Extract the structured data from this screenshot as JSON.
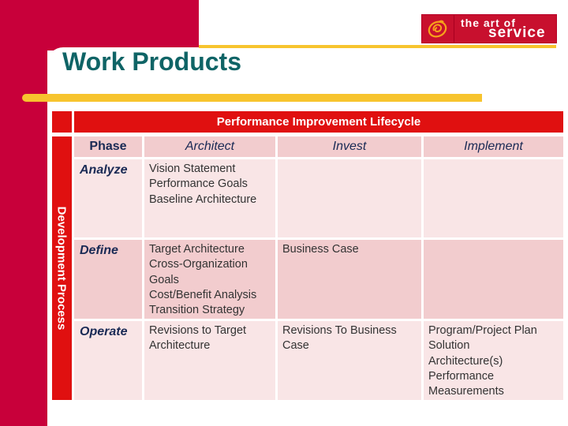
{
  "slide": {
    "title": "Work Products"
  },
  "logo": {
    "icon": "swirl-icon",
    "line1": "the art of",
    "line2": "service"
  },
  "colors": {
    "brand_red": "#c8003a",
    "table_red": "#e01010",
    "gold": "#f7c42e",
    "title_teal": "#0f6466",
    "header_cell": "#f2ccce",
    "light_cell": "#f9e5e6"
  },
  "table": {
    "banner": "Performance Improvement Lifecycle",
    "side_label": "Development Process",
    "columns": [
      "Phase",
      "Architect",
      "Invest",
      "Implement"
    ],
    "rows": [
      {
        "phase": "Analyze",
        "architect": [
          "Vision Statement",
          "Performance Goals",
          "Baseline Architecture"
        ],
        "invest": [],
        "implement": []
      },
      {
        "phase": "Define",
        "architect": [
          "Target Architecture",
          "Cross-Organization",
          "Goals",
          "Cost/Benefit Analysis",
          "Transition Strategy"
        ],
        "invest": [
          "Business Case"
        ],
        "implement": []
      },
      {
        "phase": "Operate",
        "architect": [
          "Revisions to Target",
          "Architecture"
        ],
        "invest": [
          "Revisions To Business",
          "Case"
        ],
        "implement": [
          "Program/Project Plan",
          "Solution",
          "Architecture(s)",
          "Performance",
          "Measurements"
        ]
      }
    ]
  }
}
